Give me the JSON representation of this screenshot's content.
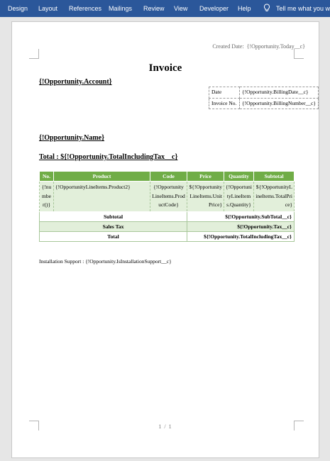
{
  "ribbon": {
    "tabs": [
      "Design",
      "Layout",
      "References",
      "Mailings",
      "Review",
      "View",
      "Developer",
      "Help"
    ],
    "tell_me": "Tell me what you wa"
  },
  "document": {
    "created_label": "Created  Date:",
    "created_value": "{!Opportunity.Today__c}",
    "title": "Invoice",
    "account": "{!Opportunity.Account}",
    "info_table": [
      {
        "label": "Date",
        "value": "{!Opportunity.BillingDate__c}"
      },
      {
        "label": "Invoice No.",
        "value": "{!Opportunity.BillingNumber__c}"
      }
    ],
    "opportunity_name": "{!Opportunity.Name}",
    "total_line": "Total : ${!Opportunity.TotalIncludingTax__c}",
    "items_table": {
      "headers": [
        "No.",
        "Product",
        "Code",
        "Price",
        "Quantity",
        "Subtotal"
      ],
      "row": [
        "{!number()}",
        "{!OpportunityLineItems.Product2}",
        "{!OpportunityLineItems.ProductCode}",
        "${!OpportunityLineItems.UnitPrice}",
        "{!OpportunityLineItems.Quantity}",
        "${!OpportunityLineItems.TotalPrice}"
      ],
      "summary": [
        {
          "label": "Subtotal",
          "value": "${!Opportunity.SubTotal__c}"
        },
        {
          "label": "Sales Tax",
          "value": "${!Opportunity.Tax__c}"
        },
        {
          "label": "Total",
          "value": "${!Opportunity.TotalIncludingTax__c}"
        }
      ]
    },
    "support_line": "Installation Support : {!Opportunity.IsInstallationSupport__c}",
    "page_number": "1 / 1"
  },
  "colors": {
    "ribbon": "#2b579a",
    "header": "#70ad47",
    "row": "#e2efda"
  },
  "icons": {
    "tell_me": "lightbulb-icon"
  }
}
